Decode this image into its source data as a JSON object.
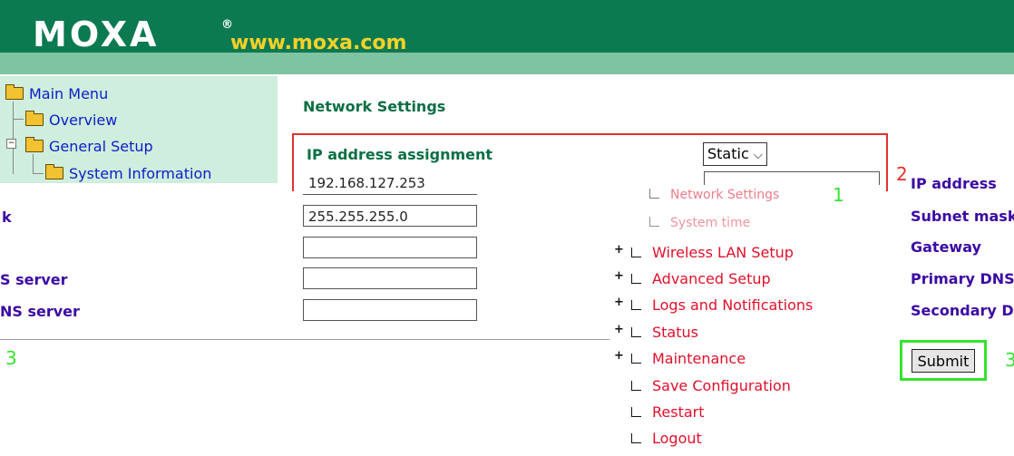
{
  "header": {
    "logo": "MOXA",
    "logo_reg": "®",
    "url": "www.moxa.com"
  },
  "tree": {
    "items": [
      {
        "label": "Main Menu"
      },
      {
        "label": "Overview"
      },
      {
        "label": "General Setup"
      },
      {
        "label": "System Information"
      }
    ]
  },
  "main": {
    "title": "Network Settings",
    "ip_assignment": {
      "label": "IP address assignment",
      "value": "Static",
      "arrow": "⌵"
    },
    "fields": [
      {
        "value": "192.168.127.253"
      },
      {
        "value": "255.255.255.0"
      },
      {
        "value": ""
      },
      {
        "value": ""
      },
      {
        "value": ""
      }
    ],
    "left_labels": [
      {
        "text": "k"
      },
      {
        "text": "S server"
      },
      {
        "text": "NS server"
      }
    ],
    "right_labels": [
      {
        "text": "IP address"
      },
      {
        "text": "Subnet mask"
      },
      {
        "text": "Gateway"
      },
      {
        "text": "Primary DNS"
      },
      {
        "text": "Secondary D"
      }
    ],
    "markers": {
      "m1": "1",
      "m2": "2",
      "m3": "3",
      "m4": "3"
    }
  },
  "menu": {
    "items": [
      {
        "label": "Network Settings",
        "plus": ""
      },
      {
        "label": "System time",
        "plus": ""
      },
      {
        "label": "Wireless LAN Setup",
        "plus": "+"
      },
      {
        "label": "Advanced Setup",
        "plus": "+"
      },
      {
        "label": "Logs and Notifications",
        "plus": "+"
      },
      {
        "label": "Status",
        "plus": "+"
      },
      {
        "label": "Maintenance",
        "plus": "+"
      },
      {
        "label": "Save Configuration",
        "plus": ""
      },
      {
        "label": "Restart",
        "plus": ""
      },
      {
        "label": "Logout",
        "plus": ""
      }
    ]
  },
  "submit": {
    "label": "Submit"
  },
  "colors": {
    "header": "#0b7a50",
    "band": "#7fc4a2",
    "tree_bg": "#cfeedd",
    "accent_red": "#e0312e",
    "accent_green": "#36e330"
  }
}
